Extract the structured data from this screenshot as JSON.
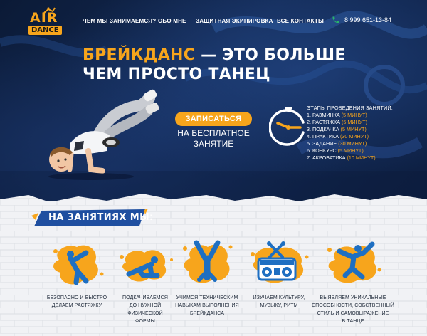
{
  "brand": {
    "logo_top": "AIR",
    "logo_bottom": "DANCE"
  },
  "nav": {
    "items": [
      {
        "label": "ЧЕМ МЫ ЗАНИМАЕМСЯ?"
      },
      {
        "label": "ОБО МНЕ"
      },
      {
        "label": "ЗАЩИТНАЯ ЭКИПИРОВКА"
      },
      {
        "label": "ВСЕ КОНТАКТЫ"
      }
    ],
    "phone": "8 999 651-13-84",
    "phone_icon": "phone-icon"
  },
  "hero": {
    "headline_accent": "БРЕЙКДАНС",
    "headline_rest_1": " — ЭТО БОЛЬШЕ",
    "headline_line_2": "ЧЕМ ПРОСТО ТАНЕЦ",
    "cta_label": "ЗАПИСАТЬСЯ",
    "cta_sub_1": "НА БЕСПЛАТНОЕ",
    "cta_sub_2": "ЗАНЯТИЕ"
  },
  "stages": {
    "title": "ЭТАПЫ ПРОВЕДЕНИЯ ЗАНЯТИЙ:",
    "items": [
      {
        "name": "1. РАЗМИНКА",
        "time": "(5 МИНУТ)"
      },
      {
        "name": "2. РАСТЯЖКА",
        "time": "(5 МИНУТ)"
      },
      {
        "name": "3. ПОДКАЧКА",
        "time": "(5 МИНУТ)"
      },
      {
        "name": "4. ПРАКТИКА",
        "time": "(30 МИНУТ)"
      },
      {
        "name": "5. ЗАДАНИЕ",
        "time": "(30 МИНУТ)"
      },
      {
        "name": "6. КОНКУРС",
        "time": "(5 МИНУТ)"
      },
      {
        "name": "7. АКРОБАТИКА",
        "time": "(10 МИНУТ)"
      }
    ]
  },
  "section": {
    "title": "НА ЗАНЯТИЯХ МЫ:",
    "features": [
      {
        "icon": "stretching-figure-icon",
        "lines": [
          "БЕЗОПАСНО И БЫСТРО",
          "ДЕЛАЕМ РАСТЯЖКУ"
        ]
      },
      {
        "icon": "pushup-figure-icon",
        "lines": [
          "ПОДКАЧИВАЕМСЯ",
          "ДО НУЖНОЙ",
          "ФИЗИЧЕСКОЙ",
          "ФОРМЫ"
        ]
      },
      {
        "icon": "handstand-figure-icon",
        "lines": [
          "УЧИМСЯ ТЕХНИЧЕСКИМ",
          "НАВЫКАМ ВЫПОЛНЕНИЯ",
          "БРЕЙКДАНСА"
        ]
      },
      {
        "icon": "boombox-icon",
        "lines": [
          "ИЗУЧАЕМ КУЛЬТУРУ,",
          "МУЗЫКУ, РИТМ"
        ]
      },
      {
        "icon": "freeze-figure-icon",
        "lines": [
          "ВЫЯВЛЯЕМ УНИКАЛЬНЫЕ",
          "СПОСОБНОСТИ, СОБСТВЕННЫЙ",
          "СТИЛЬ И САМОВЫРАЖЕНИЕ",
          "В ТАНЦЕ"
        ]
      }
    ]
  },
  "colors": {
    "accent": "#f7a51c",
    "navy": "#0b1a36",
    "icon_blue": "#1e6fc2",
    "text_dark": "#1f2a3a"
  }
}
